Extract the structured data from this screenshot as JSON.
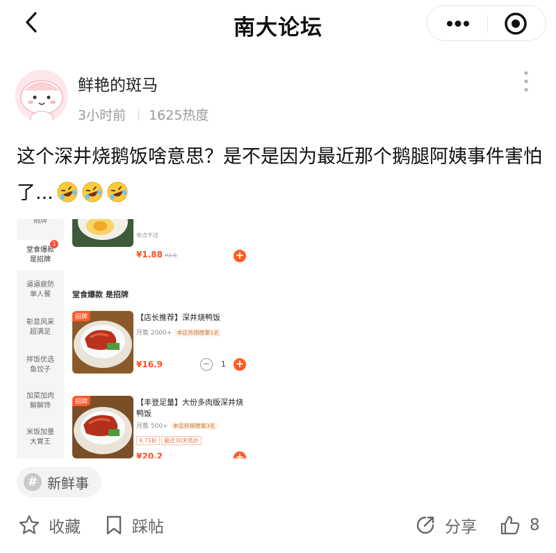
{
  "header": {
    "title": "南大论坛"
  },
  "author": {
    "name": "鲜艳的斑马",
    "time": "3小时前",
    "heat": "1625热度"
  },
  "post": {
    "text": "这个深井烧鹅饭啥意思？是不是因为最近那个鹅腿阿姨事件害怕了...",
    "emojis": [
      "rolling-on-floor-laughing",
      "rolling-on-floor-laughing",
      "rolling-on-floor-laughing"
    ]
  },
  "embedded_screenshot": {
    "sidebar": [
      {
        "label": "招牌",
        "active": false
      },
      {
        "label": "堂食爆款是招牌",
        "active": true,
        "badge": "1"
      },
      {
        "label": "逼逼疲防单人餐",
        "active": false
      },
      {
        "label": "彰显风采超满足",
        "active": false
      },
      {
        "label": "拌饭优选鱼饺子",
        "active": false
      },
      {
        "label": "加菜加肉解解馋",
        "active": false
      },
      {
        "label": "米饭加量大胃王",
        "active": false
      }
    ],
    "top_item": {
      "note": "单点不送",
      "price": "¥1.88",
      "orig_price": "¥2.5"
    },
    "section_title": "堂食爆款 是招牌",
    "dishes": [
      {
        "tag": "招牌",
        "name": "【店长推荐】深井烧鸭饭",
        "sales": "月售 2000+",
        "rank": "本店热销榜第1名",
        "price": "¥16.9",
        "qty": "1"
      },
      {
        "tag": "招牌",
        "name": "【丰登足量】大份多肉版深井烧鸭饭",
        "sales": "月售 500+",
        "rank": "本店热销榜第3名",
        "discount": "9.71折",
        "low_price": "最近30天低价",
        "price": "¥20.2"
      }
    ]
  },
  "topic": {
    "label": "新鲜事"
  },
  "actions": {
    "favorite": "收藏",
    "stomp": "踩帖",
    "share": "分享",
    "like_count": "8"
  },
  "colors": {
    "accent_orange": "#ff5a1f",
    "muted_text": "#9a9a9a",
    "avatar_bg": "#fde7ea"
  }
}
